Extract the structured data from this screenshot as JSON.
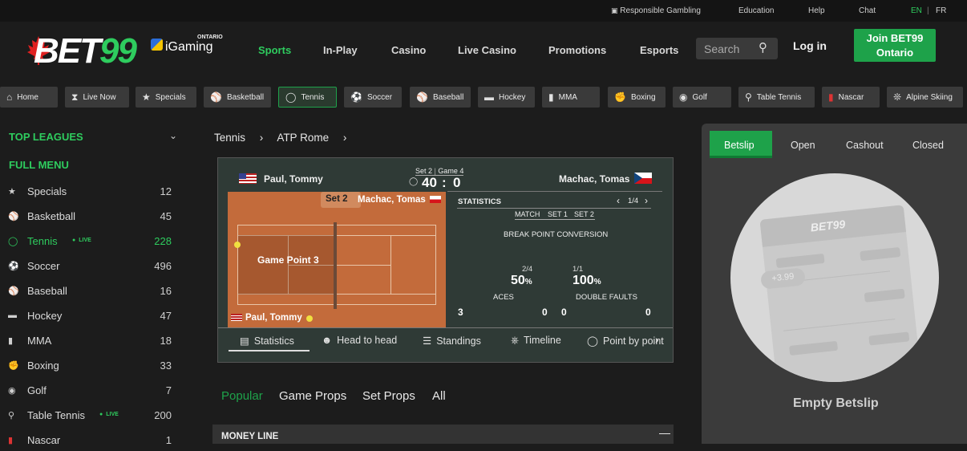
{
  "utility": {
    "responsible_gambling": "Responsible Gambling",
    "education": "Education",
    "help": "Help",
    "chat": "Chat",
    "lang_en": "EN",
    "lang_sep": "|",
    "lang_fr": "FR"
  },
  "brand": {
    "logo": "BET99",
    "partner_small": "ONTARIO",
    "partner": "iGaming",
    "green": "#1ea24a",
    "accent_text": "#2ecc5e"
  },
  "nav": {
    "items": [
      "Sports",
      "In-Play",
      "Casino",
      "Live Casino",
      "Promotions",
      "Esports"
    ],
    "search_placeholder": "Search",
    "login": "Log in",
    "join_line1": "Join BET99",
    "join_line2": "Ontario"
  },
  "chips": [
    {
      "label": "Home",
      "icon": "home-icon"
    },
    {
      "label": "Live Now",
      "icon": "broadcast-icon"
    },
    {
      "label": "Specials",
      "icon": "star-icon"
    },
    {
      "label": "Basketball",
      "icon": "basketball-icon"
    },
    {
      "label": "Tennis",
      "icon": "tennis-icon"
    },
    {
      "label": "Soccer",
      "icon": "soccer-icon"
    },
    {
      "label": "Baseball",
      "icon": "baseball-icon"
    },
    {
      "label": "Hockey",
      "icon": "hockey-icon"
    },
    {
      "label": "MMA",
      "icon": "mma-icon"
    },
    {
      "label": "Boxing",
      "icon": "boxing-icon"
    },
    {
      "label": "Golf",
      "icon": "golf-icon"
    },
    {
      "label": "Table Tennis",
      "icon": "table-tennis-icon"
    },
    {
      "label": "Nascar",
      "icon": "nascar-icon"
    },
    {
      "label": "Alpine Skiing",
      "icon": "skiing-icon"
    }
  ],
  "sidebar": {
    "top_leagues": "TOP LEAGUES",
    "full_menu": "FULL MENU",
    "live_tag": "LIVE",
    "items": [
      {
        "label": "Specials",
        "count": "12"
      },
      {
        "label": "Basketball",
        "count": "45"
      },
      {
        "label": "Tennis",
        "count": "228"
      },
      {
        "label": "Soccer",
        "count": "496"
      },
      {
        "label": "Baseball",
        "count": "16"
      },
      {
        "label": "Hockey",
        "count": "47"
      },
      {
        "label": "MMA",
        "count": "18"
      },
      {
        "label": "Boxing",
        "count": "33"
      },
      {
        "label": "Golf",
        "count": "7"
      },
      {
        "label": "Table Tennis",
        "count": "200"
      },
      {
        "label": "Nascar",
        "count": "1"
      }
    ]
  },
  "breadcrumb": {
    "sport": "Tennis",
    "sep1": "›",
    "event": "ATP Rome",
    "sep2": "›"
  },
  "match": {
    "player1": "Paul, Tommy",
    "player2": "Machac, Tomas",
    "set_label": "Set 2",
    "game_label": "Game 4",
    "score_p1": "40",
    "score_sep": ":",
    "score_p2": "0",
    "court_set": "Set 2",
    "court_player_top": "Machac, Tomas",
    "court_player_bottom": "Paul, Tommy",
    "court_event": "Game Point 3"
  },
  "stats": {
    "title": "STATISTICS",
    "page": "1/4",
    "cols": [
      "MATCH",
      "SET 1",
      "SET 2"
    ],
    "break_point_title": "BREAK POINT CONVERSION",
    "bp_left_ratio": "2/4",
    "bp_left_pct": "50",
    "bp_right_ratio": "1/1",
    "bp_right_pct": "100",
    "pct_sign": "%",
    "aces_label": "ACES",
    "aces_left": "3",
    "aces_right": "0",
    "df_label": "DOUBLE FAULTS",
    "df_left": "0",
    "df_right": "0"
  },
  "board_tabs": [
    "Statistics",
    "Head to head",
    "Standings",
    "Timeline",
    "Point by point"
  ],
  "markets": {
    "tabs": [
      "Popular",
      "Game Props",
      "Set Props",
      "All"
    ],
    "money_line": "MONEY LINE",
    "collapse": "—"
  },
  "betslip": {
    "tabs": [
      "Betslip",
      "Open",
      "Cashout",
      "Closed"
    ],
    "empty": "Empty Betslip",
    "illustration_logo": "BET99",
    "illustration_odds": "+3.99"
  }
}
